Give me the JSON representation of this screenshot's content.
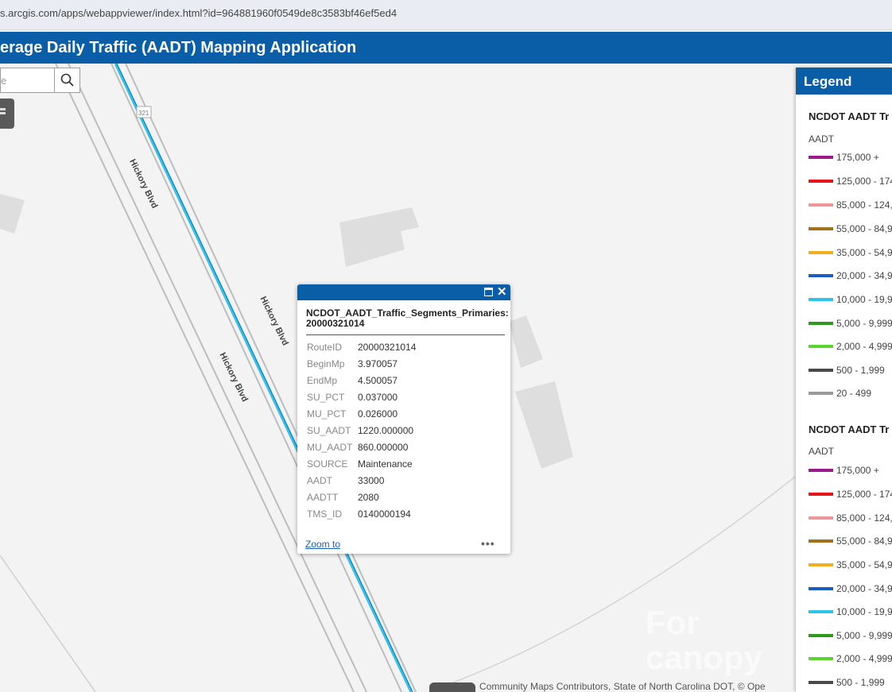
{
  "browser": {
    "url": "s.arcgis.com/apps/webappviewer/index.html?id=964881960f0549de8c3583bf46ef5ed4"
  },
  "app": {
    "title": "erage Daily Traffic (AADT) Mapping Application"
  },
  "search": {
    "text": "e"
  },
  "map": {
    "road_labels": [
      "Hickory Blvd",
      "Hickory Blvd",
      "Hickory Blvd"
    ],
    "route_shield": "321"
  },
  "popup": {
    "title": "NCDOT_AADT_Traffic_Segments_Primaries: 20000321014",
    "fields": [
      {
        "key": "RouteID",
        "value": "20000321014"
      },
      {
        "key": "BeginMp",
        "value": "3.970057"
      },
      {
        "key": "EndMp",
        "value": "4.500057"
      },
      {
        "key": "SU_PCT",
        "value": "0.037000"
      },
      {
        "key": "MU_PCT",
        "value": "0.026000"
      },
      {
        "key": "SU_AADT",
        "value": "1220.000000"
      },
      {
        "key": "MU_AADT",
        "value": "860.000000"
      },
      {
        "key": "SOURCE",
        "value": "Maintenance"
      },
      {
        "key": "AADT",
        "value": "33000"
      },
      {
        "key": "AADTT",
        "value": "2080"
      },
      {
        "key": "TMS_ID",
        "value": "0140000194"
      }
    ],
    "zoom_label": "Zoom to",
    "more_label": "•••"
  },
  "legend": {
    "header": "Legend",
    "layers": [
      {
        "title": "NCDOT AADT Tr",
        "field": "AADT",
        "items": [
          {
            "label": "175,000 +",
            "color": "#9c1a8c"
          },
          {
            "label": "125,000 - 174",
            "color": "#e8141c"
          },
          {
            "label": "85,000 - 124,",
            "color": "#f29595"
          },
          {
            "label": "55,000 - 84,9",
            "color": "#a0721c"
          },
          {
            "label": "35,000 - 54,9",
            "color": "#f2ae1c"
          },
          {
            "label": "20,000 - 34,9",
            "color": "#1a5ec0"
          },
          {
            "label": "10,000 - 19,9",
            "color": "#2ec6e8"
          },
          {
            "label": "5,000 - 9,999",
            "color": "#2e9a1c"
          },
          {
            "label": "2,000 - 4,999",
            "color": "#5ad42e"
          },
          {
            "label": "500 - 1,999",
            "color": "#4a4a4a"
          },
          {
            "label": "20 - 499",
            "color": "#9a9a9a"
          }
        ]
      },
      {
        "title": "NCDOT AADT Tr",
        "field": "AADT",
        "items": [
          {
            "label": "175,000 +",
            "color": "#9c1a8c"
          },
          {
            "label": "125,000 - 174",
            "color": "#e8141c"
          },
          {
            "label": "85,000 - 124,",
            "color": "#f29595"
          },
          {
            "label": "55,000 - 84,9",
            "color": "#a0721c"
          },
          {
            "label": "35,000 - 54,9",
            "color": "#f2ae1c"
          },
          {
            "label": "20,000 - 34,9",
            "color": "#1a5ec0"
          },
          {
            "label": "10,000 - 19,9",
            "color": "#2ec6e8"
          },
          {
            "label": "5,000 - 9,999",
            "color": "#2e9a1c"
          },
          {
            "label": "2,000 - 4,999",
            "color": "#5ad42e"
          },
          {
            "label": "500 - 1,999",
            "color": "#4a4a4a"
          }
        ]
      }
    ]
  },
  "attribution": {
    "text": "Community Maps Contributors, State of North Carolina DOT, © Ope"
  },
  "watermark": {
    "text": "For\ncanopy"
  },
  "colors": {
    "brand_blue": "#0a5ea8",
    "aadt_line": "#2ec6e8"
  }
}
